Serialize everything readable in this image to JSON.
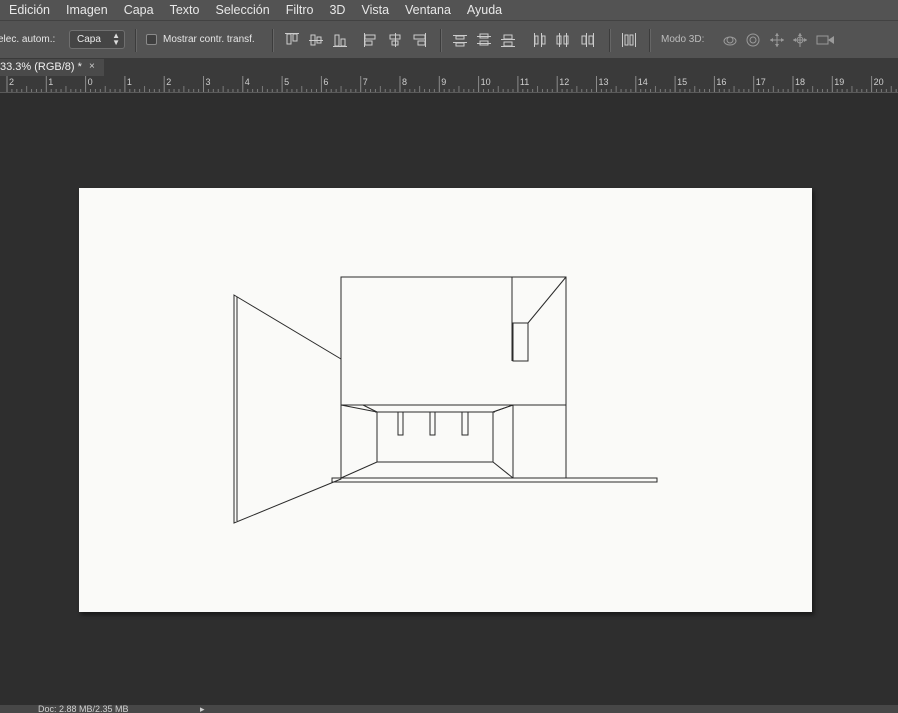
{
  "menu": [
    "Edición",
    "Imagen",
    "Capa",
    "Texto",
    "Selección",
    "Filtro",
    "3D",
    "Vista",
    "Ventana",
    "Ayuda"
  ],
  "options": {
    "auto_select_label": "elec. autom.:",
    "auto_select_value": "Capa",
    "show_transform_label": "Mostrar contr. transf.",
    "mode3d_label": "Modo 3D:"
  },
  "document_tab": {
    "title": "33.3% (RGB/8) *",
    "close": "×"
  },
  "ruler": {
    "labels": [
      "2",
      "1",
      "0",
      "1",
      "2",
      "3",
      "4",
      "5",
      "6",
      "7",
      "8",
      "9",
      "10",
      "11",
      "12",
      "13",
      "14",
      "15",
      "16",
      "17",
      "18",
      "19",
      "20"
    ]
  },
  "status": {
    "doc_info": "Doc: 2.88 MB/2.35 MB",
    "arrow": "▸"
  }
}
